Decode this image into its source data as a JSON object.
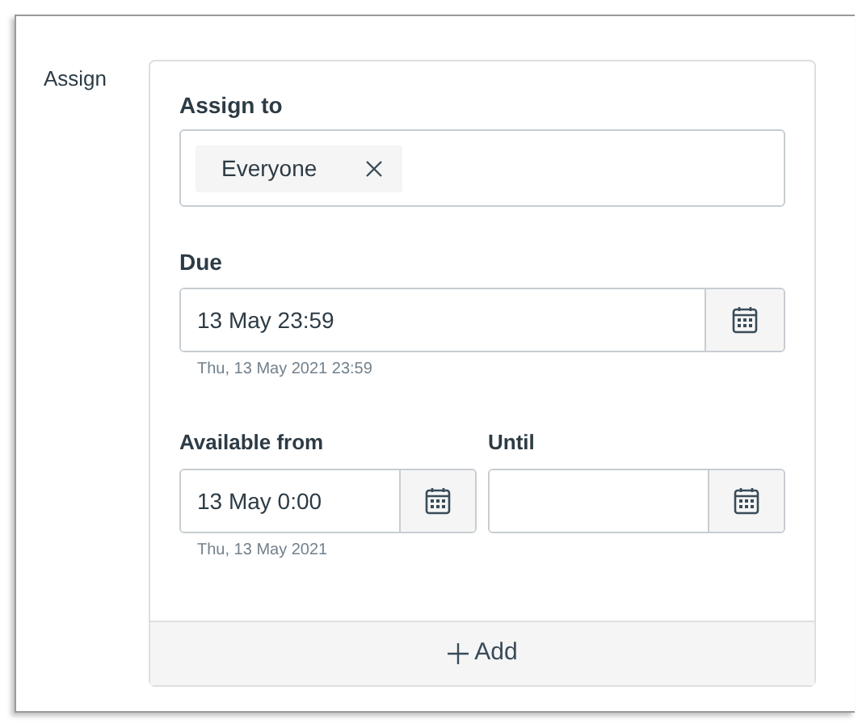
{
  "section_label": "Assign",
  "assign_to": {
    "label": "Assign to",
    "chips": [
      {
        "text": "Everyone"
      }
    ]
  },
  "due": {
    "label": "Due",
    "value": "13 May 23:59",
    "hint": "Thu, 13 May 2021 23:59"
  },
  "available_from": {
    "label": "Available from",
    "value": "13 May 0:00",
    "hint": "Thu, 13 May 2021"
  },
  "until": {
    "label": "Until"
  },
  "add_button": {
    "label": "Add"
  }
}
